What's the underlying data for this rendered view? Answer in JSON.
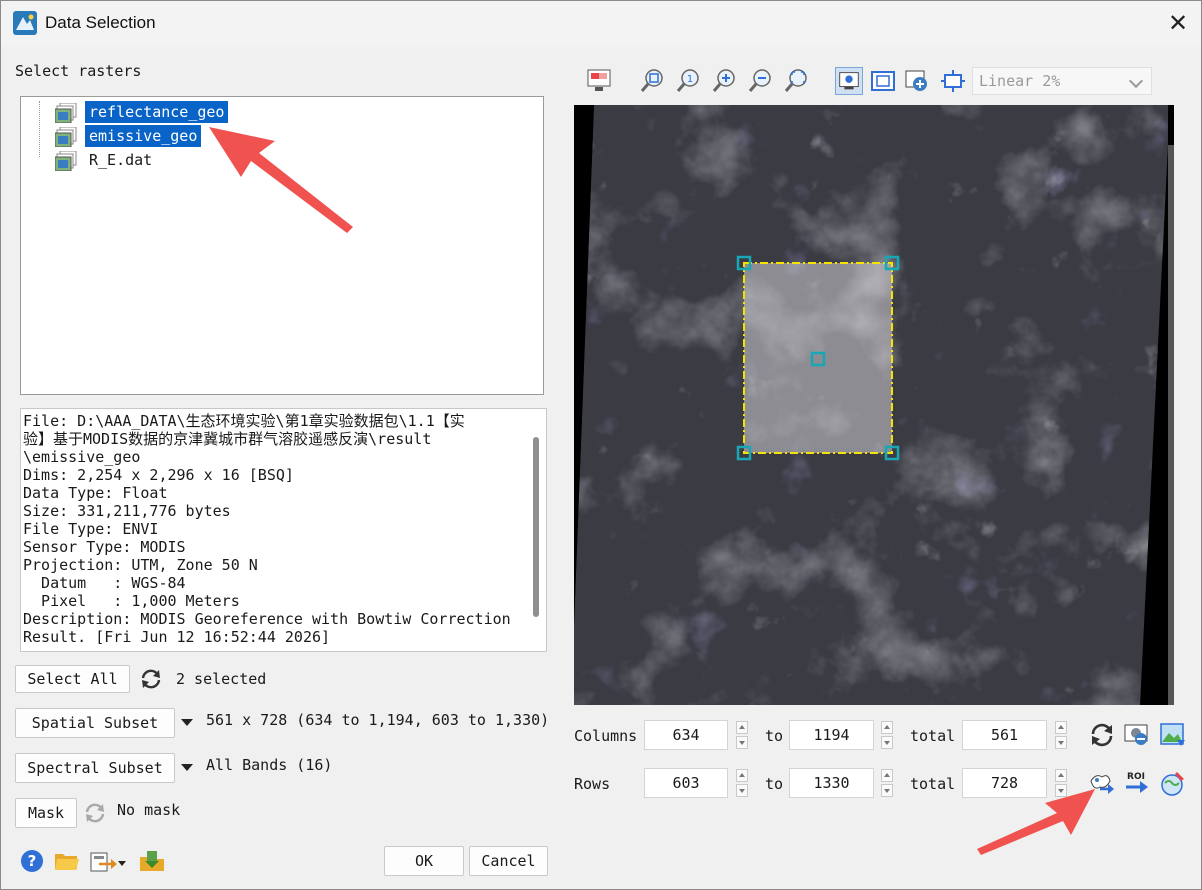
{
  "window": {
    "title": "Data Selection"
  },
  "left": {
    "select_label": "Select rasters",
    "rasters": [
      {
        "name": "reflectance_geo",
        "selected": true
      },
      {
        "name": "emissive_geo",
        "selected": true
      },
      {
        "name": "R_E.dat",
        "selected": false
      }
    ],
    "info": {
      "file": "File: D:\\AAA_DATA\\生态环境实验\\第1章实验数据包\\1.1【实",
      "file2": "验】基于MODIS数据的京津冀城市群气溶胶遥感反演\\result",
      "file3": "\\emissive_geo",
      "dims": "Dims: 2,254 x 2,296 x 16 [BSQ]",
      "data_type": "Data Type: Float",
      "size": "Size: 331,211,776 bytes",
      "file_type": "File Type: ENVI",
      "sensor": "Sensor Type: MODIS",
      "projection": "Projection: UTM, Zone 50 N",
      "datum": "  Datum   : WGS-84",
      "pixel": "  Pixel   : 1,000 Meters",
      "description": "Description: MODIS Georeference with Bowtiw Correction",
      "result": "Result. [Fri Jun 12 16:52:44 2026]"
    },
    "select_all_label": "Select All",
    "selected_count": "2 selected",
    "spatial_subset_label": "Spatial Subset",
    "spatial_subset_value": "561 x 728 (634 to 1,194, 603 to 1,330)",
    "spectral_subset_label": "Spectral Subset",
    "spectral_subset_value": "All Bands (16)",
    "mask_label": "Mask",
    "mask_value": "No mask",
    "ok_label": "OK",
    "cancel_label": "Cancel"
  },
  "right": {
    "stretch": "Linear 2%",
    "columns_label": "Columns",
    "rows_label": "Rows",
    "to_label": "to",
    "total_label": "total",
    "col_from": "634",
    "col_to": "1194",
    "col_total": "561",
    "row_from": "603",
    "row_to": "1330",
    "row_total": "728",
    "roi_label": "ROI"
  },
  "colors": {
    "selection": "#0a64c8",
    "subset_box": "#f5e400",
    "handle": "#17a7b5",
    "annotation_arrow": "#f0524f"
  },
  "icons": [
    "app-icon",
    "close-icon",
    "raster-file-icon",
    "refresh-icon",
    "dropdown-arrow-icon",
    "help-icon",
    "open-folder-icon",
    "export-icon",
    "save-icon",
    "reset-display-icon",
    "zoom-fit-icon",
    "zoom-1-icon",
    "zoom-in-icon",
    "zoom-out-icon",
    "zoom-full-icon",
    "view-image-icon",
    "full-extent-icon",
    "pan-icon",
    "center-icon",
    "refresh-subset-icon",
    "preview-icon",
    "image-icon",
    "geo-subset-icon",
    "roi-subset-icon",
    "map-subset-icon"
  ]
}
